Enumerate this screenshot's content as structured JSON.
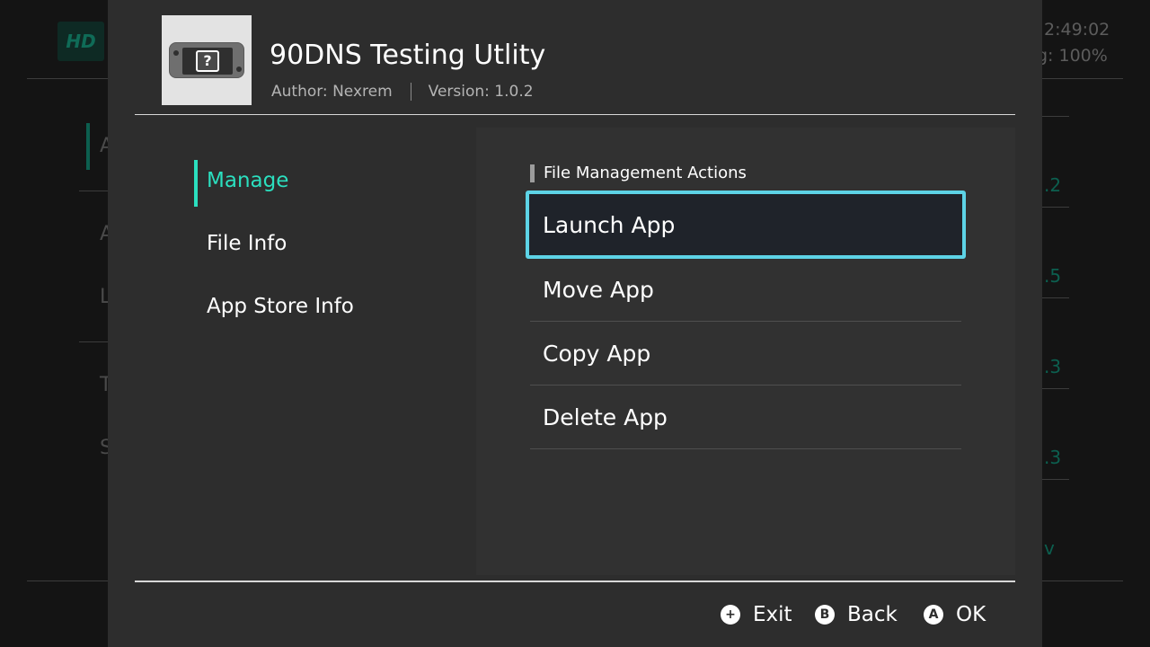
{
  "background": {
    "logo_text": "HD",
    "clock": "2:49:02",
    "battery": "g: 100%",
    "left_letters": [
      "A",
      "A",
      "L",
      "T",
      "S"
    ],
    "right_numbers": [
      ".2",
      ".5",
      ".3",
      ".3",
      "v"
    ]
  },
  "dialog": {
    "app_title": "90DNS Testing Utlity",
    "author": "Author: Nexrem",
    "version": "Version: 1.0.2",
    "icon": "console-question-icon",
    "nav": [
      {
        "label": "Manage",
        "active": true
      },
      {
        "label": "File Info",
        "active": false
      },
      {
        "label": "App Store Info",
        "active": false
      }
    ],
    "section_title": "File Management Actions",
    "actions": [
      {
        "label": "Launch App",
        "focused": true
      },
      {
        "label": "Move App",
        "focused": false
      },
      {
        "label": "Copy App",
        "focused": false
      },
      {
        "label": "Delete App",
        "focused": false
      }
    ],
    "footer": [
      {
        "button": "+",
        "label": "Exit"
      },
      {
        "button": "B",
        "label": "Back"
      },
      {
        "button": "A",
        "label": "OK"
      }
    ]
  },
  "colors": {
    "accent": "#2bdfbf",
    "focus_border": "#5dd3e6",
    "dialog_bg": "#2d2d2d"
  }
}
